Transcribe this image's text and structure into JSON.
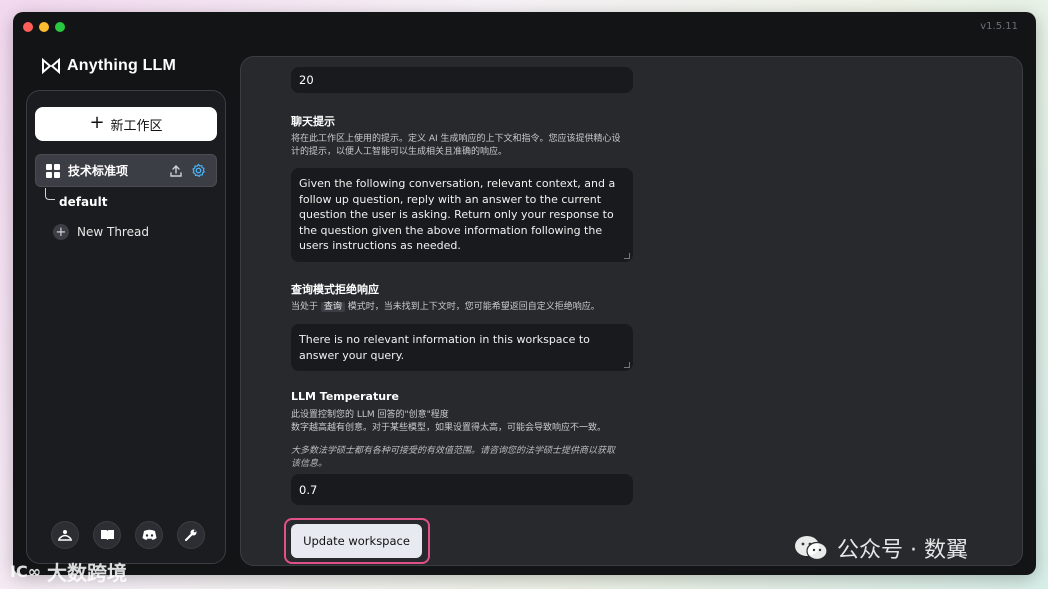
{
  "app": {
    "name": "Anything LLM",
    "version": "v1.5.11"
  },
  "sidebar": {
    "new_workspace_label": "新工作区",
    "workspace": {
      "name": "技术标准项"
    },
    "threads": [
      {
        "label": "default"
      }
    ],
    "new_thread_label": "New Thread",
    "footer_icons": [
      "community-hub-icon",
      "docs-book-icon",
      "discord-icon",
      "wrench-icon"
    ]
  },
  "settings": {
    "history_value": "20",
    "chat_prompt": {
      "title": "聊天提示",
      "desc_line1": "将在此工作区上使用的提示。定义 AI 生成响应的上下文和指令。您应该提供精心设",
      "desc_line2": "计的提示，以便人工智能可以生成相关且准确的响应。",
      "value": "Given the following conversation, relevant context, and a follow up question, reply with an answer to the current question the user is asking. Return only your response to the question given the above information following the users instructions as needed."
    },
    "query_refusal": {
      "title": "查询模式拒绝响应",
      "desc_before": "当处于",
      "desc_code": "查询",
      "desc_after": "模式时，当未找到上下文时，您可能希望返回自定义拒绝响应。",
      "value": "There is no relevant information in this workspace to answer your query."
    },
    "temperature": {
      "title": "LLM Temperature",
      "desc_line1": "此设置控制您的 LLM 回答的\"创意\"程度",
      "desc_line2": "数字越高越有创意。对于某些模型，如果设置得太高，可能会导致响应不一致。",
      "note_line1": "大多数法学硕士都有各种可接受的有效值范围。请咨询您的法学硕士提供商以获取",
      "note_line2": "该信息。",
      "value": "0.7"
    },
    "update_button_label": "Update workspace"
  },
  "watermarks": {
    "left": "大数跨境",
    "left_logo": "IC∞",
    "right": "公众号 · 数翼"
  },
  "colors": {
    "window_bg": "#131416",
    "panel_bg": "#27292d",
    "input_bg": "#191a1d",
    "highlight": "#e2508a",
    "accent_gear": "#4db8ff"
  }
}
